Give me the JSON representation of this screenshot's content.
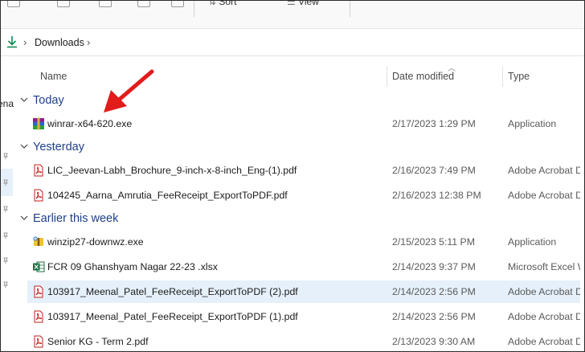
{
  "toolbar": {
    "sort_label": "Sort",
    "view_label": "View"
  },
  "address": {
    "crumb": "Downloads"
  },
  "nav": {
    "partial_label": "ena"
  },
  "columns": {
    "name": "Name",
    "date": "Date modified",
    "type": "Type"
  },
  "groups": {
    "today": "Today",
    "yesterday": "Yesterday",
    "earlier": "Earlier this week"
  },
  "files": [
    {
      "name": "winrar-x64-620.exe",
      "date": "2/17/2023 1:29 PM",
      "type": "Application",
      "icon": "winrar-icon"
    },
    {
      "name": "LIC_Jeevan-Labh_Brochure_9-inch-x-8-inch_Eng-(1).pdf",
      "date": "2/16/2023 7:49 PM",
      "type": "Adobe Acrobat D...",
      "icon": "pdf-icon"
    },
    {
      "name": "104245_Aarna_Amrutia_FeeReceipt_ExportToPDF.pdf",
      "date": "2/16/2023 12:38 PM",
      "type": "Adobe Acrobat D...",
      "icon": "pdf-icon"
    },
    {
      "name": "winzip27-downwz.exe",
      "date": "2/15/2023 5:11 PM",
      "type": "Application",
      "icon": "winzip-icon"
    },
    {
      "name": "FCR 09 Ghanshyam Nagar 22-23 .xlsx",
      "date": "2/14/2023 9:37 PM",
      "type": "Microsoft Excel W",
      "icon": "excel-icon"
    },
    {
      "name": "103917_Meenal_Patel_FeeReceipt_ExportToPDF (2).pdf",
      "date": "2/14/2023 2:56 PM",
      "type": "Adobe Acrobat D...",
      "icon": "pdf-icon"
    },
    {
      "name": "103917_Meenal_Patel_FeeReceipt_ExportToPDF (1).pdf",
      "date": "2/14/2023 2:56 PM",
      "type": "Adobe Acrobat D...",
      "icon": "pdf-icon"
    },
    {
      "name": "Senior KG - Term 2.pdf",
      "date": "2/13/2023 9:30 AM",
      "type": "Adobe Acrobat D...",
      "icon": "pdf-icon"
    }
  ],
  "colors": {
    "accent": "#1f3f8a",
    "selection": "#e5f0fb",
    "annotation": "#e21b1b",
    "download": "#0f8a55"
  }
}
